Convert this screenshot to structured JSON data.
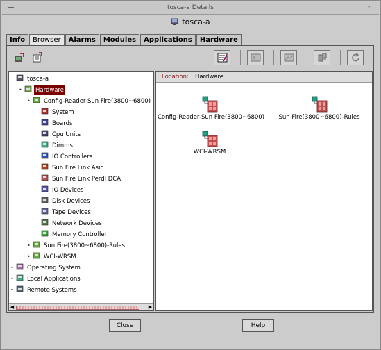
{
  "window": {
    "title": "tosca-a Details",
    "minimize_label": "-",
    "close_label": "·"
  },
  "header": {
    "host": "tosca-a"
  },
  "tabs": [
    {
      "label": "Info"
    },
    {
      "label": "Browser",
      "active": true
    },
    {
      "label": "Alarms"
    },
    {
      "label": "Modules"
    },
    {
      "label": "Applications"
    },
    {
      "label": "Hardware"
    }
  ],
  "toolbar": {
    "left_icons": [
      "tree-view-icon",
      "properties-icon"
    ],
    "right_icons": [
      "icon-view-icon",
      "list-view-icon",
      "graph-view-icon",
      "module-icon",
      "refresh-icon"
    ]
  },
  "tree": [
    {
      "label": "tosca-a",
      "icon": "host-icon",
      "expander": ""
    },
    {
      "label": "Hardware",
      "icon": "hardware-icon",
      "expander": "•",
      "selected": true
    },
    {
      "label": "Config-Reader-Sun Fire(3800~6800)",
      "icon": "config-reader-icon",
      "expander": "•"
    },
    {
      "label": "System",
      "icon": "system-icon"
    },
    {
      "label": "Boards",
      "icon": "boards-icon"
    },
    {
      "label": "Cpu Units",
      "icon": "cpu-icon"
    },
    {
      "label": "Dimms",
      "icon": "dimm-icon"
    },
    {
      "label": "IO Controllers",
      "icon": "io-controller-icon"
    },
    {
      "label": "Sun Fire Link Asic",
      "icon": "link-asic-icon"
    },
    {
      "label": "Sun Fire Link Perdl DCA",
      "icon": "link-dca-icon"
    },
    {
      "label": "IO Devices",
      "icon": "io-device-icon"
    },
    {
      "label": "Disk Devices",
      "icon": "disk-icon"
    },
    {
      "label": "Tape Devices",
      "icon": "tape-icon"
    },
    {
      "label": "Network Devices",
      "icon": "network-icon"
    },
    {
      "label": "Memory Controller",
      "icon": "memory-controller-icon"
    },
    {
      "label": "Sun Fire(3800~6800)-Rules",
      "icon": "rules-icon",
      "expander": "•"
    },
    {
      "label": "WCI-WRSM",
      "icon": "wci-icon",
      "expander": "•"
    },
    {
      "label": "Operating System",
      "icon": "os-icon",
      "expander": "•"
    },
    {
      "label": "Local Applications",
      "icon": "applications-icon",
      "expander": "•"
    },
    {
      "label": "Remote Systems",
      "icon": "remote-systems-icon",
      "expander": "•"
    }
  ],
  "location": {
    "label": "Location:",
    "value": "Hardware"
  },
  "objects": [
    {
      "label": "Config-Reader-Sun Fire(3800~6800)"
    },
    {
      "label": "Sun Fire(3800~6800)-Rules"
    },
    {
      "label": "WCI-WRSM"
    }
  ],
  "buttons": {
    "close": "Close",
    "help": "Help"
  },
  "colors": {
    "selection": "#7a0000",
    "location_label": "#8a2020",
    "module_icon": "#c05050"
  }
}
